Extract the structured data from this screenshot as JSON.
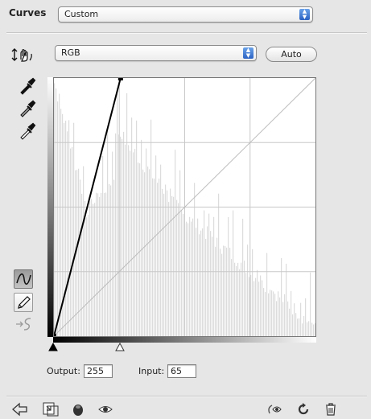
{
  "header": {
    "title": "Curves",
    "preset_value": "Custom"
  },
  "channel": {
    "value": "RGB",
    "auto_label": "Auto"
  },
  "curve": {
    "input_range": [
      0,
      255
    ],
    "output_range": [
      0,
      255
    ],
    "points": [
      [
        0,
        0
      ],
      [
        65,
        255
      ]
    ]
  },
  "fields": {
    "output_label": "Output:",
    "output_value": "255",
    "input_label": "Input:",
    "input_value": "65"
  },
  "colors": {
    "panel": "#e6e6e6",
    "histogram": "#dcdcdc",
    "grid": "#c8c8c8",
    "curve": "#000000",
    "popup_accent": "#2c63c3"
  },
  "icons": {
    "targeted_adjust": "hand-adjust-icon",
    "black_point": "black-eyedropper-icon",
    "gray_point": "gray-eyedropper-icon",
    "white_point": "white-eyedropper-icon",
    "curve_mode": "curve-tool-icon",
    "pencil_mode": "pencil-tool-icon",
    "smooth": "smooth-curve-icon"
  }
}
